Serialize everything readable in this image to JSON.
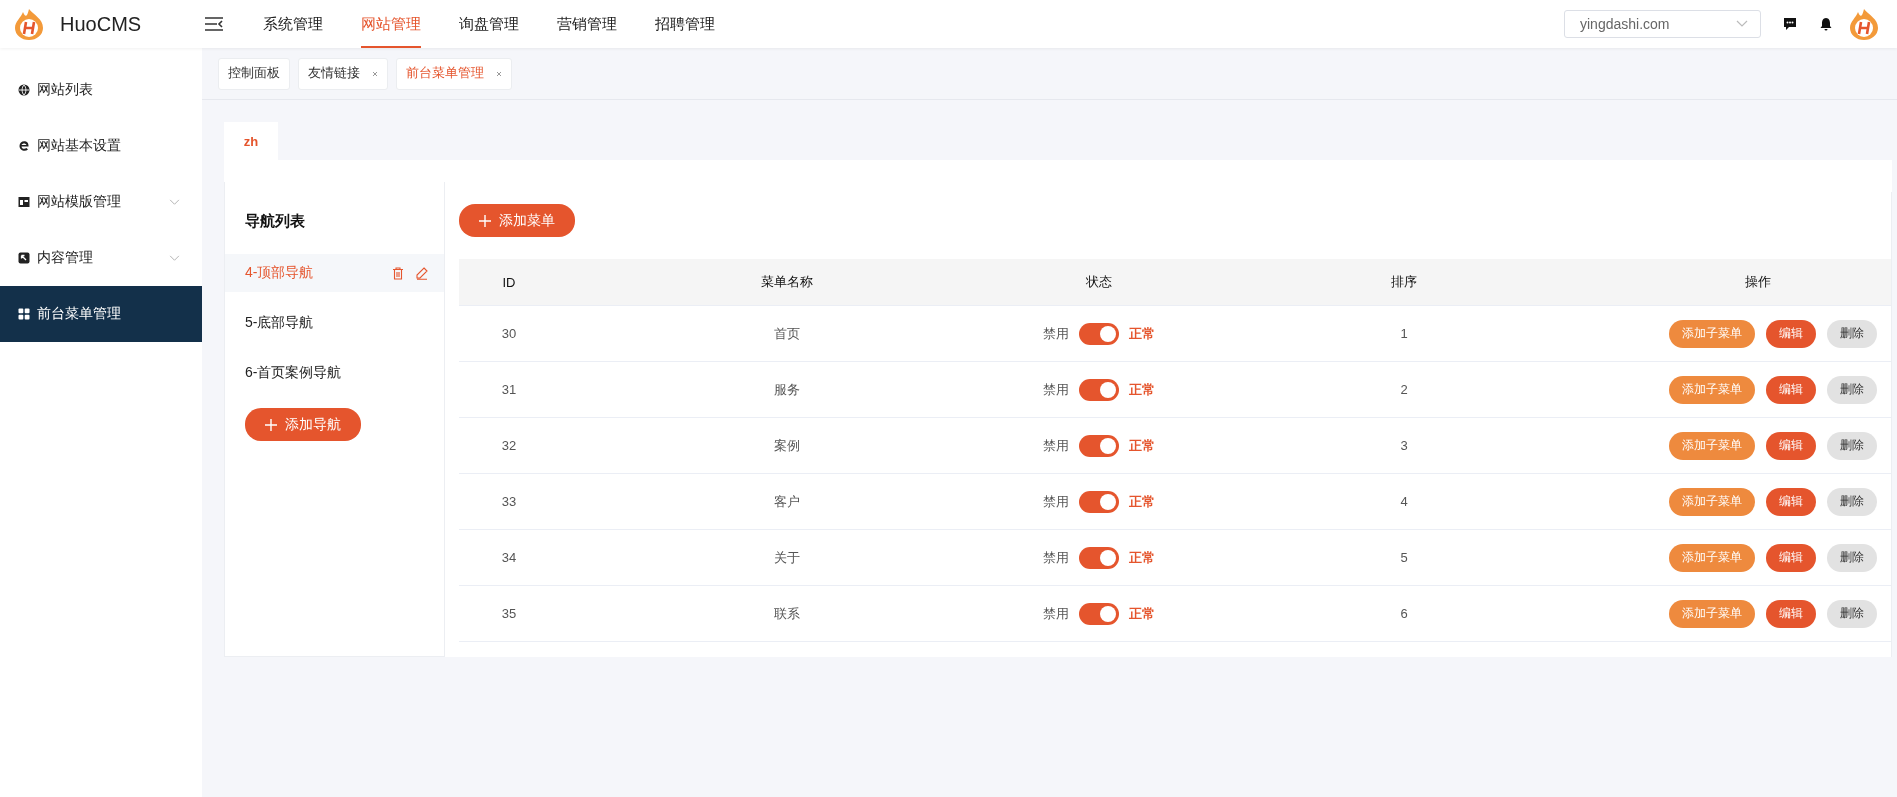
{
  "header": {
    "logo_text": "HuoCMS",
    "nav": [
      {
        "label": "系统管理",
        "selected": false
      },
      {
        "label": "网站管理",
        "selected": true
      },
      {
        "label": "询盘管理",
        "selected": false
      },
      {
        "label": "营销管理",
        "selected": false
      },
      {
        "label": "招聘管理",
        "selected": false
      }
    ],
    "site_select": "yingdashi.com"
  },
  "sidebar": {
    "items": [
      {
        "label": "网站列表",
        "expandable": false,
        "selected": false
      },
      {
        "label": "网站基本设置",
        "expandable": false,
        "selected": false
      },
      {
        "label": "网站模版管理",
        "expandable": true,
        "selected": false
      },
      {
        "label": "内容管理",
        "expandable": true,
        "selected": false
      },
      {
        "label": "前台菜单管理",
        "expandable": false,
        "selected": true
      }
    ]
  },
  "tabs": [
    {
      "label": "控制面板",
      "closable": false,
      "selected": false
    },
    {
      "label": "友情链接",
      "closable": true,
      "selected": false
    },
    {
      "label": "前台菜单管理",
      "closable": true,
      "selected": true
    }
  ],
  "lang_tabs": [
    {
      "label": "zh",
      "selected": true
    }
  ],
  "nav_panel": {
    "title": "导航列表",
    "items": [
      {
        "label": "4-顶部导航",
        "selected": true
      },
      {
        "label": "5-底部导航",
        "selected": false
      },
      {
        "label": "6-首页案例导航",
        "selected": false
      }
    ],
    "add_button": "添加导航"
  },
  "menu_table": {
    "add_button": "添加菜单",
    "columns": [
      "ID",
      "菜单名称",
      "状态",
      "排序",
      "操作"
    ],
    "rows": [
      {
        "id": "30",
        "name": "首页",
        "off_label": "禁用",
        "on": true,
        "on_label": "正常",
        "sort": "1",
        "actions": [
          {
            "kind": "add",
            "label": "添加子菜单"
          },
          {
            "kind": "edit",
            "label": "编辑"
          },
          {
            "kind": "delete",
            "label": "删除"
          }
        ]
      },
      {
        "id": "31",
        "name": "服务",
        "off_label": "禁用",
        "on": true,
        "on_label": "正常",
        "sort": "2",
        "actions": [
          {
            "kind": "add",
            "label": "添加子菜单"
          },
          {
            "kind": "edit",
            "label": "编辑"
          },
          {
            "kind": "delete",
            "label": "删除"
          }
        ]
      },
      {
        "id": "32",
        "name": "案例",
        "off_label": "禁用",
        "on": true,
        "on_label": "正常",
        "sort": "3",
        "actions": [
          {
            "kind": "add",
            "label": "添加子菜单"
          },
          {
            "kind": "edit",
            "label": "编辑"
          },
          {
            "kind": "delete",
            "label": "删除"
          }
        ]
      },
      {
        "id": "33",
        "name": "客户",
        "off_label": "禁用",
        "on": true,
        "on_label": "正常",
        "sort": "4",
        "actions": [
          {
            "kind": "add",
            "label": "添加子菜单"
          },
          {
            "kind": "edit",
            "label": "编辑"
          },
          {
            "kind": "delete",
            "label": "删除"
          }
        ]
      },
      {
        "id": "34",
        "name": "关于",
        "off_label": "禁用",
        "on": true,
        "on_label": "正常",
        "sort": "5",
        "actions": [
          {
            "kind": "add",
            "label": "添加子菜单"
          },
          {
            "kind": "edit",
            "label": "编辑"
          },
          {
            "kind": "delete",
            "label": "删除"
          }
        ]
      },
      {
        "id": "35",
        "name": "联系",
        "off_label": "禁用",
        "on": true,
        "on_label": "正常",
        "sort": "6",
        "actions": [
          {
            "kind": "add",
            "label": "添加子菜单"
          },
          {
            "kind": "edit",
            "label": "编辑"
          },
          {
            "kind": "delete",
            "label": "删除"
          }
        ]
      }
    ]
  }
}
